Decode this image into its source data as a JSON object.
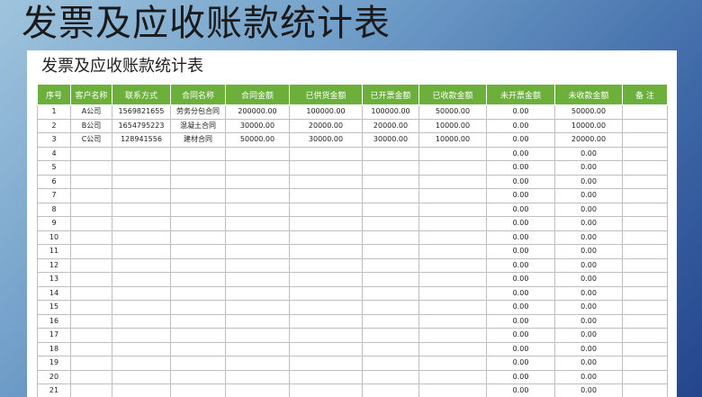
{
  "page": {
    "big_title": "发票及应收账款统计表",
    "sheet_title": "发票及应收账款统计表"
  },
  "colors": {
    "header_green": "#6cb03b",
    "header_text": "#ffffff",
    "background_blue": "#3f6aa8"
  },
  "table": {
    "headers": [
      "序号",
      "客户名称",
      "联系方式",
      "合同名称",
      "合同金额",
      "已供货金额",
      "已开票金额",
      "已收款金额",
      "未开票金额",
      "未收款金额",
      "备 注"
    ],
    "rows": [
      [
        "1",
        "A公司",
        "1569821655",
        "劳务分包合同",
        "200000.00",
        "100000.00",
        "100000.00",
        "50000.00",
        "0.00",
        "50000.00",
        ""
      ],
      [
        "2",
        "B公司",
        "1654795223",
        "混凝土合同",
        "30000.00",
        "20000.00",
        "20000.00",
        "10000.00",
        "0.00",
        "10000.00",
        ""
      ],
      [
        "3",
        "C公司",
        "128941556",
        "建材合同",
        "50000.00",
        "30000.00",
        "30000.00",
        "10000.00",
        "0.00",
        "20000.00",
        ""
      ],
      [
        "4",
        "",
        "",
        "",
        "",
        "",
        "",
        "",
        "0.00",
        "0.00",
        ""
      ],
      [
        "5",
        "",
        "",
        "",
        "",
        "",
        "",
        "",
        "0.00",
        "0.00",
        ""
      ],
      [
        "6",
        "",
        "",
        "",
        "",
        "",
        "",
        "",
        "0.00",
        "0.00",
        ""
      ],
      [
        "7",
        "",
        "",
        "",
        "",
        "",
        "",
        "",
        "0.00",
        "0.00",
        ""
      ],
      [
        "8",
        "",
        "",
        "",
        "",
        "",
        "",
        "",
        "0.00",
        "0.00",
        ""
      ],
      [
        "9",
        "",
        "",
        "",
        "",
        "",
        "",
        "",
        "0.00",
        "0.00",
        ""
      ],
      [
        "10",
        "",
        "",
        "",
        "",
        "",
        "",
        "",
        "0.00",
        "0.00",
        ""
      ],
      [
        "11",
        "",
        "",
        "",
        "",
        "",
        "",
        "",
        "0.00",
        "0.00",
        ""
      ],
      [
        "12",
        "",
        "",
        "",
        "",
        "",
        "",
        "",
        "0.00",
        "0.00",
        ""
      ],
      [
        "13",
        "",
        "",
        "",
        "",
        "",
        "",
        "",
        "0.00",
        "0.00",
        ""
      ],
      [
        "14",
        "",
        "",
        "",
        "",
        "",
        "",
        "",
        "0.00",
        "0.00",
        ""
      ],
      [
        "15",
        "",
        "",
        "",
        "",
        "",
        "",
        "",
        "0.00",
        "0.00",
        ""
      ],
      [
        "16",
        "",
        "",
        "",
        "",
        "",
        "",
        "",
        "0.00",
        "0.00",
        ""
      ],
      [
        "17",
        "",
        "",
        "",
        "",
        "",
        "",
        "",
        "0.00",
        "0.00",
        ""
      ],
      [
        "18",
        "",
        "",
        "",
        "",
        "",
        "",
        "",
        "0.00",
        "0.00",
        ""
      ],
      [
        "19",
        "",
        "",
        "",
        "",
        "",
        "",
        "",
        "0.00",
        "0.00",
        ""
      ],
      [
        "20",
        "",
        "",
        "",
        "",
        "",
        "",
        "",
        "0.00",
        "0.00",
        ""
      ],
      [
        "21",
        "",
        "",
        "",
        "",
        "",
        "",
        "",
        "0.00",
        "0.00",
        ""
      ]
    ]
  }
}
